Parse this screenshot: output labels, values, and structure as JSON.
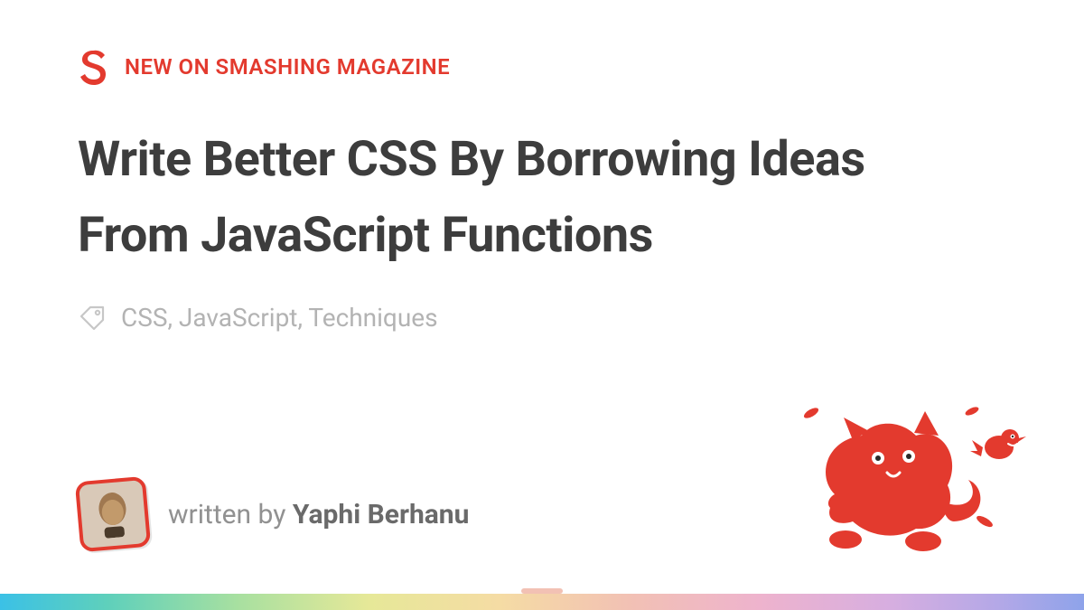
{
  "brand": {
    "kicker": "NEW ON SMASHING MAGAZINE",
    "accent": "#e33a2e"
  },
  "article": {
    "title": "Write Better CSS By Borrowing Ideas From JavaScript Functions",
    "tags_display": "CSS, JavaScript, Techniques",
    "tags": [
      "CSS",
      "JavaScript",
      "Techniques"
    ]
  },
  "author": {
    "prefix": "written by ",
    "name": "Yaphi Berhanu"
  }
}
